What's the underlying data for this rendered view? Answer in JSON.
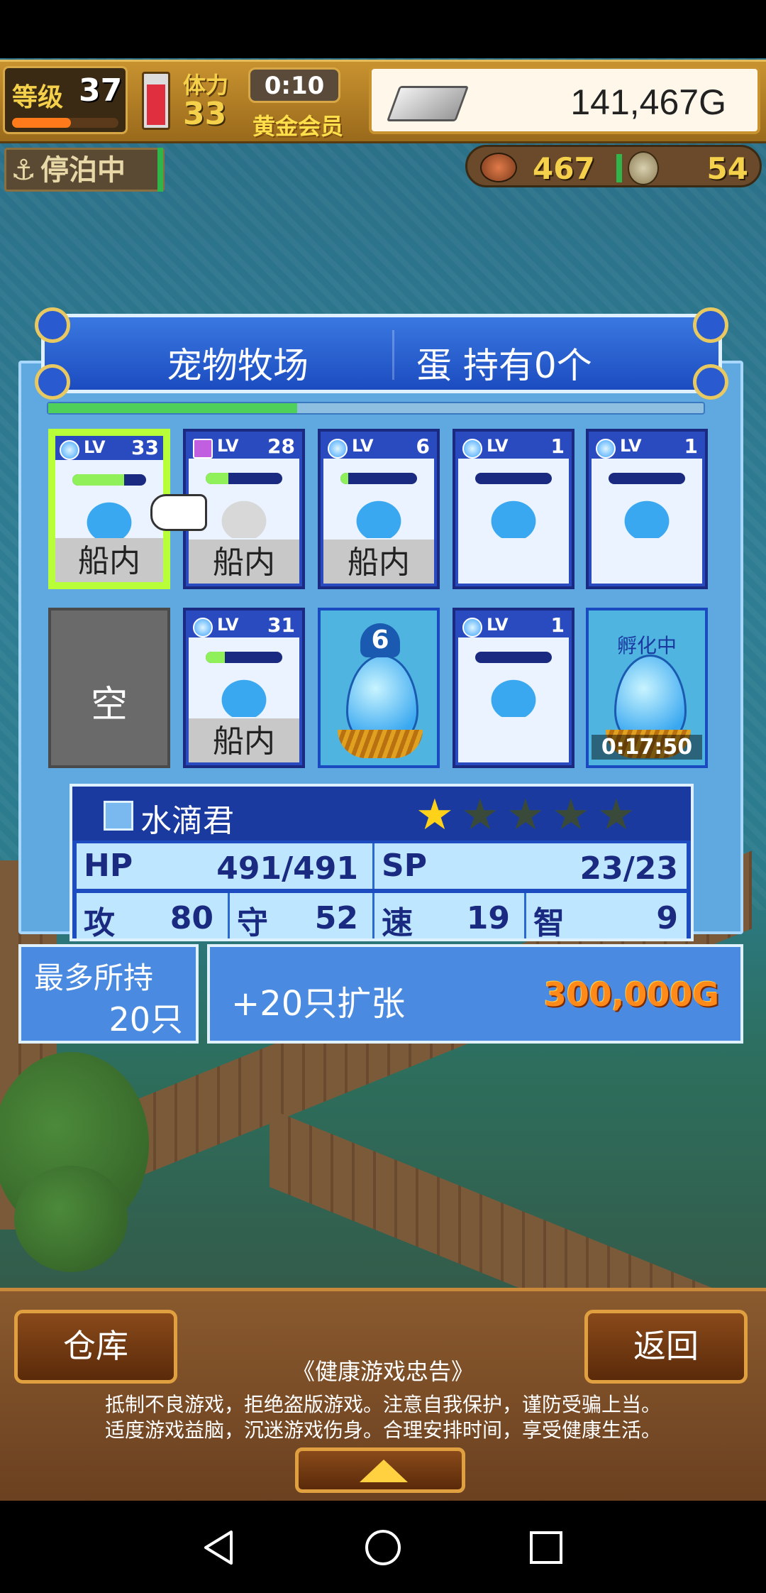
{
  "hud": {
    "level_label": "等级",
    "level_value": "37",
    "level_progress": 0.55,
    "stamina_label": "体力",
    "stamina_value": "33",
    "stamina_fill": 0.85,
    "timer": "0:10",
    "member_label": "黄金会员",
    "gold": "141,467G",
    "anchor_status": "停泊中",
    "meat": "467",
    "coins": "54"
  },
  "ranch": {
    "title": "宠物牧场",
    "eggs_label": "蛋 持有0个",
    "page_progress": 0.38
  },
  "slots": [
    {
      "type": "pet",
      "level": "33",
      "element": "water",
      "status": "船内",
      "hp": 0.7,
      "selected": true
    },
    {
      "type": "pet",
      "level": "28",
      "element": "purple",
      "status": "船内",
      "hp": 0.3
    },
    {
      "type": "pet",
      "level": "6",
      "element": "water",
      "status": "船内",
      "hp": 0.1
    },
    {
      "type": "pet",
      "level": "1",
      "element": "water",
      "status": "",
      "hp": 0
    },
    {
      "type": "pet",
      "level": "1",
      "element": "water",
      "status": "",
      "hp": 0
    },
    {
      "type": "empty",
      "label": "空"
    },
    {
      "type": "pet",
      "level": "31",
      "element": "water",
      "status": "船内",
      "hp": 0.25
    },
    {
      "type": "egg",
      "badge": "6"
    },
    {
      "type": "pet",
      "level": "1",
      "element": "water",
      "status": "",
      "hp": 0
    },
    {
      "type": "hatching",
      "label": "孵化中",
      "timer": "0:17:50"
    }
  ],
  "slot_lv_text": "LV",
  "detail": {
    "name": "水滴君",
    "stars_filled": 1,
    "stars_total": 5,
    "hp_key": "HP",
    "hp": "491/491",
    "sp_key": "SP",
    "sp": "23/23",
    "atk_key": "攻",
    "atk": "80",
    "def_key": "守",
    "def": "52",
    "spd_key": "速",
    "spd": "19",
    "int_key": "智",
    "int": "9"
  },
  "capacity": {
    "label": "最多所持",
    "value": "20只"
  },
  "expand": {
    "label": "+20只扩张",
    "price": "300,000G"
  },
  "bottom": {
    "warehouse_label": "仓库",
    "back_label": "返回",
    "health_title": "《健康游戏忠告》",
    "health_line1": "抵制不良游戏，拒绝盗版游戏。注意自我保护，谨防受骗上当。",
    "health_line2": "适度游戏益脑，沉迷游戏伤身。合理安排时间，享受健康生活。"
  },
  "colors": {
    "accent": "#1c4cc0",
    "selected": "#b8ff3a",
    "gold_text": "#ff8a1a"
  }
}
